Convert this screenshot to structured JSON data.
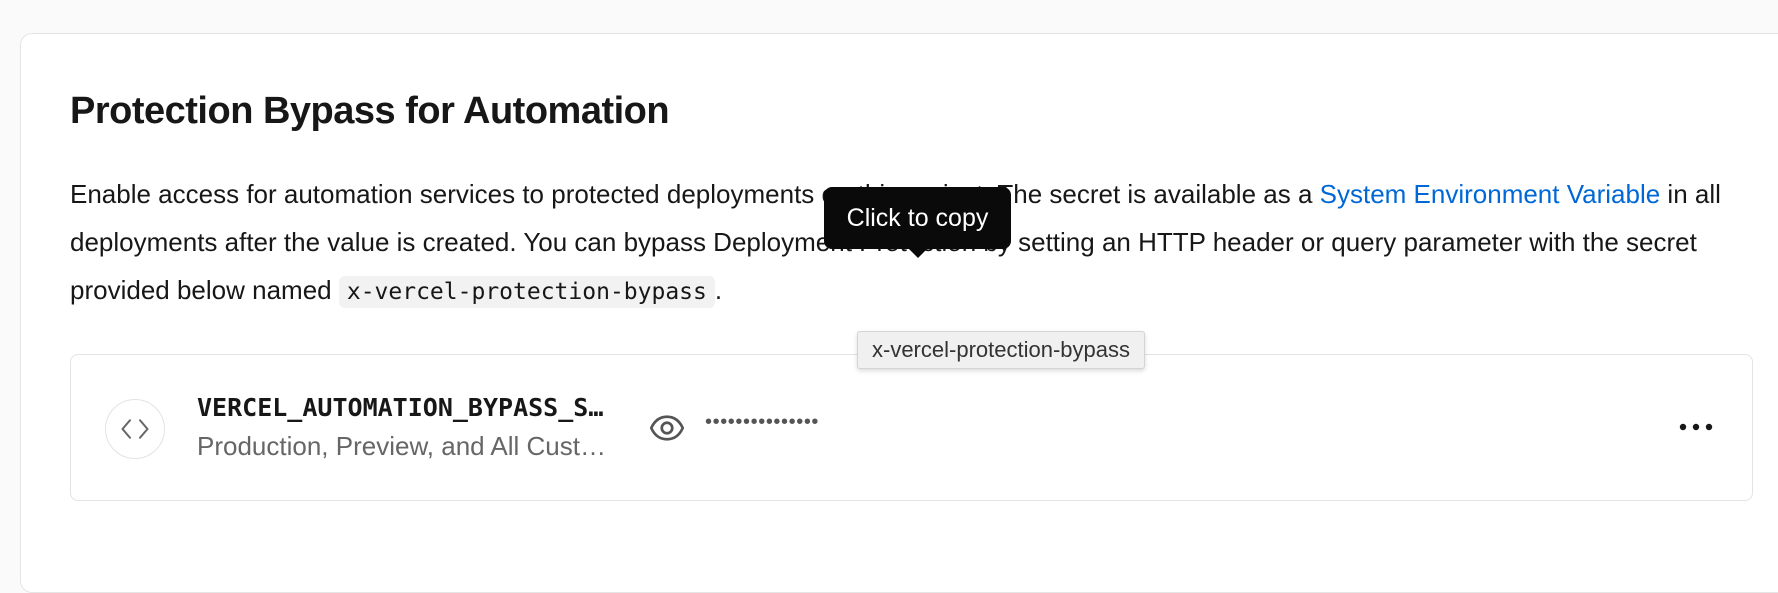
{
  "section": {
    "title": "Protection Bypass for Automation",
    "description_part1": "Enable access for automation services to protected deployments on this project. The secret is available as a ",
    "link_label": "System Environment Variable",
    "description_part2": " in all deployments after the value is created. You can bypass Deployment Protection by setting an HTTP header or query parameter with the secret provided below named ",
    "header_name": "x-vercel-protection-bypass",
    "description_end": "."
  },
  "tooltips": {
    "copy": "Click to copy",
    "name_hover": "x-vercel-protection-bypass"
  },
  "env_var": {
    "name": "VERCEL_AUTOMATION_BYPASS_SECRET",
    "environments": "Production, Preview, and All Custom Environments",
    "masked_value": "•••••••••••••••",
    "icons": {
      "type": "code-icon",
      "reveal": "eye-icon",
      "menu": "more-horizontal-icon"
    }
  }
}
